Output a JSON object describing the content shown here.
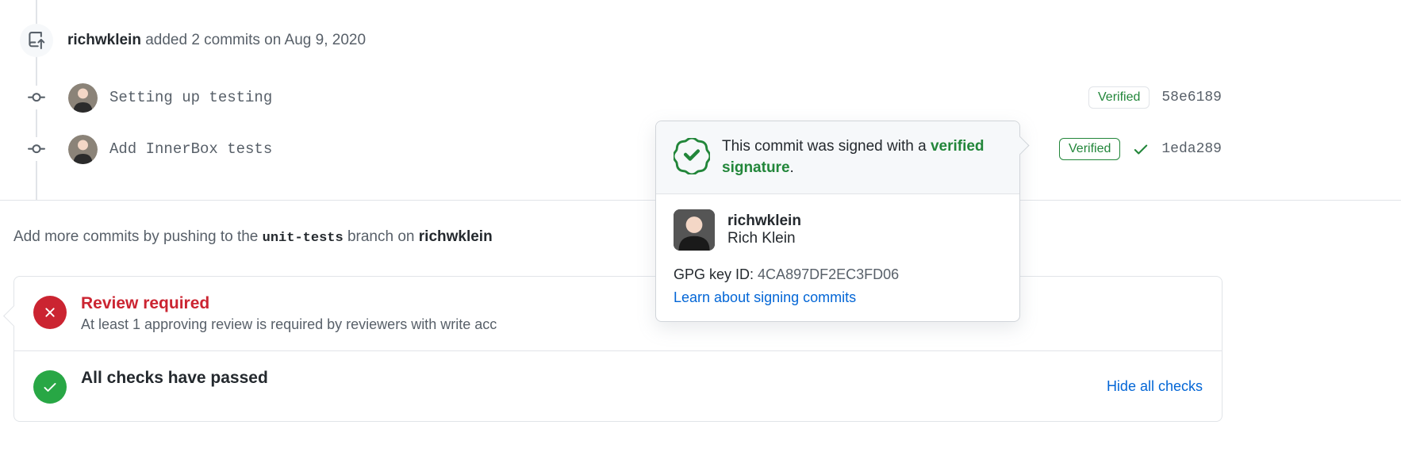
{
  "push_event": {
    "user": "richwklein",
    "action": "added 2 commits",
    "date": "on Aug 9, 2020"
  },
  "commits": [
    {
      "message": "Setting up testing",
      "verified_label": "Verified",
      "sha": "58e6189",
      "has_check": false,
      "outline": false
    },
    {
      "message": "Add InnerBox tests",
      "verified_label": "Verified",
      "sha": "1eda289",
      "has_check": true,
      "outline": true
    }
  ],
  "push_hint": {
    "prefix": "Add more commits by pushing to the",
    "branch": "unit-tests",
    "middle": "branch on",
    "repo": "richwklein"
  },
  "merge": {
    "review": {
      "title": "Review required",
      "sub": "At least 1 approving review is required by reviewers with write acc"
    },
    "checks": {
      "title": "All checks have passed",
      "hide": "Hide all checks"
    }
  },
  "popover": {
    "line1": "This commit was signed with a",
    "signature": "verified signature",
    "period": ".",
    "username": "richwklein",
    "realname": "Rich Klein",
    "keyid_label": "GPG key ID:",
    "keyid": "4CA897DF2EC3FD06",
    "learn": "Learn about signing commits"
  }
}
